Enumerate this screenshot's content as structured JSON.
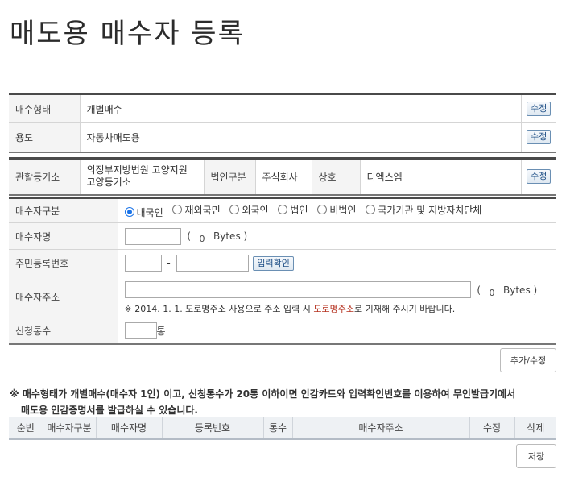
{
  "page": {
    "title": "매도용 매수자 등록"
  },
  "section1": {
    "rows": [
      {
        "label": "매수형태",
        "value": "개별매수",
        "button": "수정"
      },
      {
        "label": "용도",
        "value": "자동차매도용",
        "button": "수정"
      }
    ]
  },
  "section2": {
    "jurisdiction_label": "관할등기소",
    "jurisdiction_value_line1": "의정부지방법원 고양지원",
    "jurisdiction_value_line2": "고양등기소",
    "corp_type_label": "법인구분",
    "corp_type_value": "주식회사",
    "company_label": "상호",
    "company_value": "디엑스엠",
    "button": "수정"
  },
  "form": {
    "buyer_type": {
      "label": "매수자구분",
      "options": [
        "내국인",
        "재외국민",
        "외국인",
        "법인",
        "비법인",
        "국가기관 및 지방자치단체"
      ],
      "selected": "내국인"
    },
    "buyer_name": {
      "label": "매수자명",
      "bytes_open": "(",
      "bytes_count": "0",
      "bytes_unit": "Bytes )"
    },
    "resident_no": {
      "label": "주민등록번호",
      "dash": "-",
      "confirm_button": "입력확인"
    },
    "address": {
      "label": "매수자주소",
      "bytes_open": "(",
      "bytes_count": "0",
      "bytes_unit": "Bytes )",
      "note_prefix": "※ 2014. 1. 1. 도로명주소 사용으로 주소 입력 시 ",
      "note_highlight": "도로명주소",
      "note_suffix": "로 기재해 주시기 바랍니다."
    },
    "copies": {
      "label": "신청통수",
      "unit": "통"
    }
  },
  "buttons": {
    "add_edit": "추가/수정",
    "save": "저장"
  },
  "notice": {
    "line1": "※ 매수형태가 개별매수(매수자 1인) 이고, 신청통수가 20통 이하이면 인감카드와 입력확인번호를 이용하여 무인발급기에서",
    "line2": "매도용 인감증명서를 발급하실 수 있습니다."
  },
  "list_table": {
    "headers": [
      "순번",
      "매수자구분",
      "매수자명",
      "등록번호",
      "통수",
      "매수자주소",
      "수정",
      "삭제"
    ]
  },
  "colors": {
    "accent": "#1a73e8",
    "highlight_red": "#b5311f",
    "border_dark": "#4a4a4a"
  }
}
